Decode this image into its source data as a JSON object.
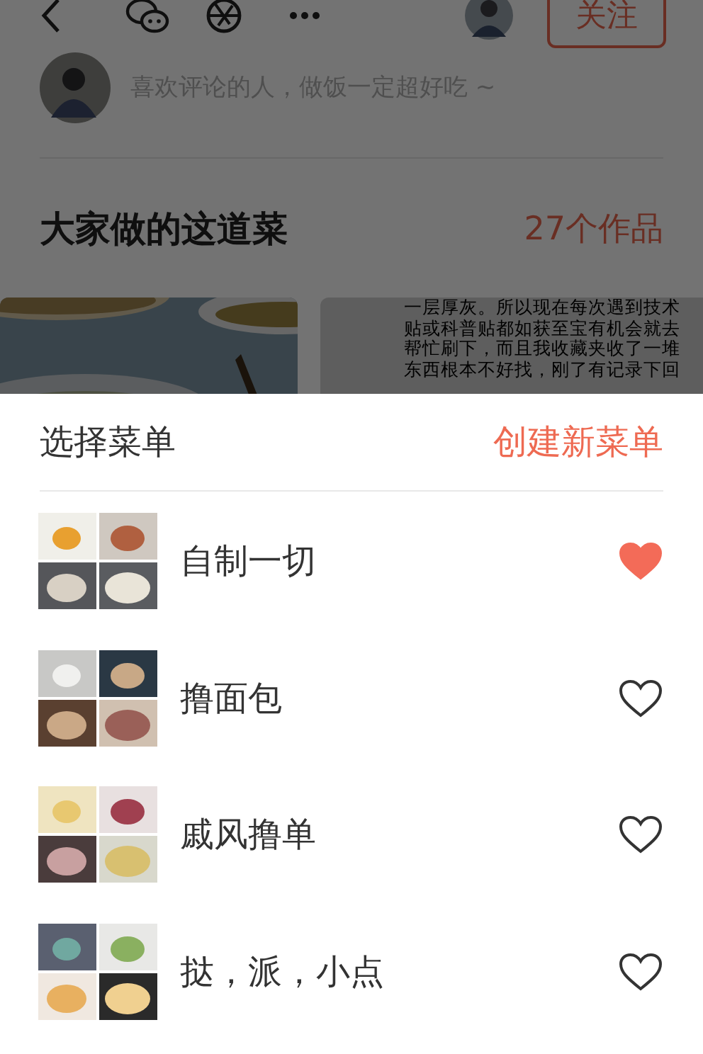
{
  "header": {
    "follow_button": "关注"
  },
  "comment": {
    "placeholder": "喜欢评论的人，做饭一定超好吃 ~"
  },
  "works_section": {
    "title": "大家做的这道菜",
    "count": "27个作品"
  },
  "works": [
    {
      "kind": "picture"
    },
    {
      "kind": "text",
      "lines": [
        "一层厚灰。所以现在每次遇到技术",
        "贴或科普贴都如获至宝有机会就去",
        "帮忙刷下，而且我收藏夹收了一堆",
        "东西根本不好找，刚了有记录下回"
      ]
    }
  ],
  "sheet": {
    "title": "选择菜单",
    "create_link": "创建新菜单",
    "menus": [
      {
        "name": "自制一切",
        "saved": true
      },
      {
        "name": "撸面包",
        "saved": false
      },
      {
        "name": "戚风撸单",
        "saved": false
      },
      {
        "name": "挞，派，小点",
        "saved": false
      }
    ]
  }
}
